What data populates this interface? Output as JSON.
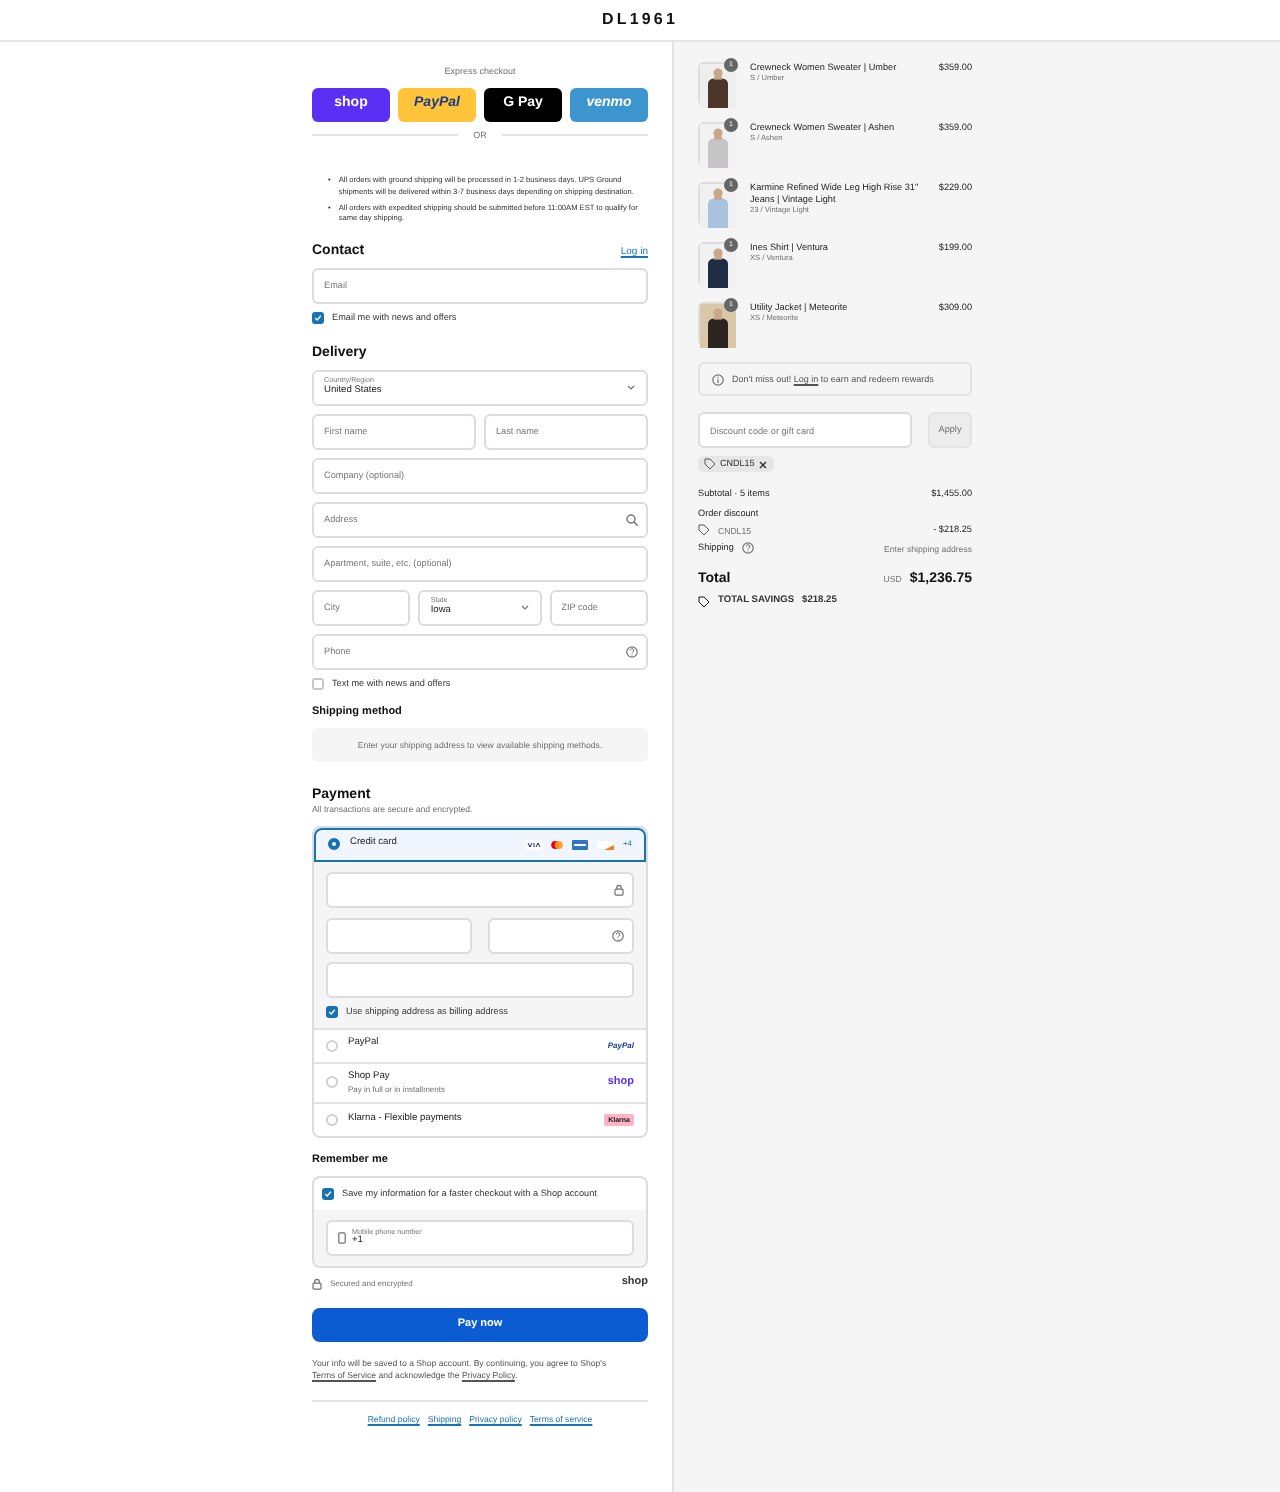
{
  "header": {
    "logo": "DL1961"
  },
  "express": {
    "label": "Express checkout",
    "buttons": [
      {
        "kind": "shop",
        "label": "shop"
      },
      {
        "kind": "paypal",
        "label": "PayPal"
      },
      {
        "kind": "gpay",
        "label": "G Pay"
      },
      {
        "kind": "venmo",
        "label": "venmo"
      }
    ],
    "divider": "OR"
  },
  "notices": [
    {
      "marker": "•",
      "text": "All orders with ground shipping will be processed in 1-2 business days. UPS Ground shipments will be delivered within 3-7 business days depending on shipping destination."
    },
    {
      "marker": "•",
      "text": "All orders with expedited shipping should be submitted before 11:00AM EST to qualify for same day shipping."
    }
  ],
  "contact": {
    "title": "Contact",
    "login": "Log in",
    "email": {
      "placeholder": "Email"
    },
    "newsletter": {
      "label": "Email me with news and offers",
      "checked": true
    }
  },
  "delivery": {
    "title": "Delivery",
    "rows": [
      [
        {
          "kind": "select",
          "label": "Country/Region",
          "value": "United States"
        }
      ],
      [
        {
          "kind": "input",
          "placeholder": "First name"
        },
        {
          "kind": "input",
          "placeholder": "Last name"
        }
      ],
      [
        {
          "kind": "input",
          "placeholder": "Company (optional)"
        }
      ],
      [
        {
          "kind": "input",
          "placeholder": "Address"
        }
      ],
      [
        {
          "kind": "input",
          "placeholder": "Apartment, suite, etc. (optional)"
        }
      ],
      [
        {
          "kind": "input",
          "placeholder": "City"
        },
        {
          "kind": "select",
          "label": "State",
          "value": "Iowa"
        },
        {
          "kind": "input",
          "placeholder": "ZIP code"
        }
      ],
      [
        {
          "kind": "input",
          "placeholder": "Phone"
        }
      ]
    ],
    "sms": {
      "label": "Text me with news and offers",
      "checked": false
    }
  },
  "shipping_method": {
    "title": "Shipping method",
    "message": "Enter your shipping address to view available shipping methods."
  },
  "payment": {
    "title": "Payment",
    "subtitle": "All transactions are secure and encrypted.",
    "methods": [
      {
        "kind": "card",
        "label": "Credit card",
        "selected": true,
        "more": "+4",
        "billing": {
          "label": "Use shipping address as billing address",
          "checked": true
        }
      },
      {
        "kind": "paypal",
        "label": "PayPal",
        "selected": false,
        "logo": "PayPal"
      },
      {
        "kind": "shop",
        "label": "Shop Pay",
        "sub": "Pay in full or in installments",
        "selected": false,
        "logo": "shop"
      },
      {
        "kind": "klarna",
        "label": "Klarna - Flexible payments",
        "selected": false,
        "logo": "Klarna"
      }
    ]
  },
  "remember": {
    "title": "Remember me",
    "save": {
      "label": "Save my information for a faster checkout with a Shop account",
      "checked": true
    },
    "phone": {
      "label": "Mobile phone number",
      "value": "+1"
    },
    "secure": "Secured and encrypted",
    "brand": "shop"
  },
  "pay_button": "Pay now",
  "terms": [
    {
      "kind": "text",
      "text": "Your info will be saved to a Shop account. By continuing, you agree to Shop's "
    },
    {
      "kind": "link",
      "text": "Terms of Service"
    },
    {
      "kind": "text",
      "text": " and acknowledge the "
    },
    {
      "kind": "link",
      "text": "Privacy Policy"
    },
    {
      "kind": "text",
      "text": "."
    }
  ],
  "footer_links": [
    "Refund policy",
    "Shipping",
    "Privacy policy",
    "Terms of service"
  ],
  "cart": {
    "items": [
      {
        "name": "Crewneck Women Sweater | Umber",
        "variant": "S / Umber",
        "price": "$359.00",
        "quantity": "1"
      },
      {
        "name": "Crewneck Women Sweater | Ashen",
        "variant": "S / Ashen",
        "price": "$359.00",
        "quantity": "1"
      },
      {
        "name": "Karmine Refined Wide Leg High Rise 31\" Jeans | Vintage Light",
        "variant": "23 / Vintage Light",
        "price": "$229.00",
        "quantity": "1"
      },
      {
        "name": "Ines Shirt | Ventura",
        "variant": "XS / Ventura",
        "price": "$199.00",
        "quantity": "1"
      },
      {
        "name": "Utility Jacket | Meteorite",
        "variant": "XS / Meteorite",
        "price": "$309.00",
        "quantity": "1"
      }
    ],
    "rewards": {
      "before": "Don't miss out!",
      "link": "Log in",
      "after": "to earn and redeem rewards"
    },
    "discount": {
      "placeholder": "Discount code or gift card",
      "button": "Apply",
      "tag": "CNDL15"
    },
    "subtotal": {
      "label": "Subtotal · 5 items",
      "value": "$1,455.00"
    },
    "order_discount": {
      "label": "Order discount",
      "code": "CNDL15",
      "value": "- $218.25"
    },
    "shipping": {
      "label": "Shipping",
      "value": "Enter shipping address"
    },
    "total": {
      "label": "Total",
      "currency": "USD",
      "value": "$1,236.75"
    },
    "savings": {
      "label": "TOTAL SAVINGS",
      "value": "$218.25"
    }
  }
}
